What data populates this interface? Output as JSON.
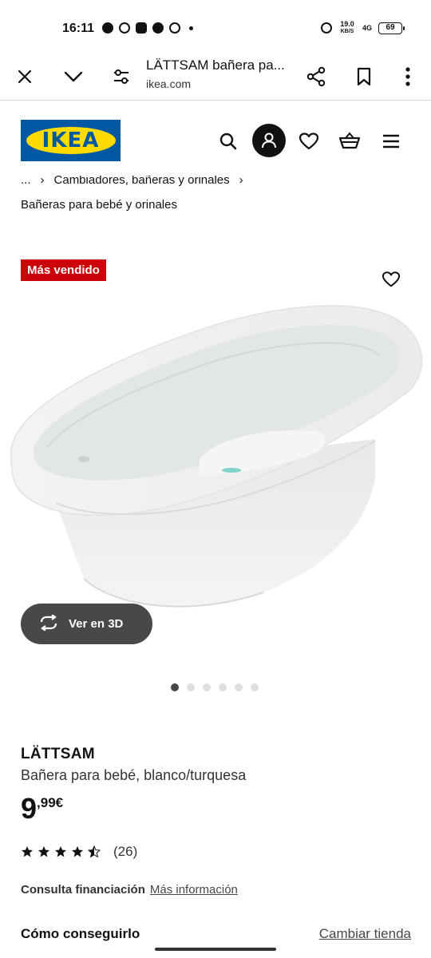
{
  "status_bar": {
    "time": "16:11",
    "net_speed_value": "19.0",
    "net_speed_unit": "KB/S",
    "signal": "4G",
    "battery": "69"
  },
  "browser": {
    "page_title": "LÄTTSAM bañera pa...",
    "domain": "ikea.com",
    "icons": [
      "close-icon",
      "chevron-down-icon",
      "tune-icon",
      "share-icon",
      "bookmark-icon",
      "more-vert-icon"
    ]
  },
  "header": {
    "logo_text": "IKEA",
    "logo_colors": {
      "blue": "#0058a3",
      "yellow": "#ffdb00"
    },
    "icons": [
      "search-icon",
      "account-icon",
      "heart-icon",
      "basket-icon",
      "menu-icon"
    ]
  },
  "breadcrumb": {
    "ellipsis": "...",
    "parent": "Cambiadores, bañeras y orinales",
    "current": "Bañeras para bebé y orinales"
  },
  "gallery": {
    "badge": "Más vendido",
    "badge_color": "#cc0008",
    "view3d_label": "Ver en 3D",
    "image_count": 6,
    "active_image": 1
  },
  "product": {
    "name": "LÄTTSAM",
    "description": "Bañera para bebé, blanco/turquesa",
    "price_integer": "9",
    "price_decimal": ",99€",
    "rating": 4.5,
    "review_count": "(26)"
  },
  "financing": {
    "label": "Consulta financiación",
    "link": "Más información"
  },
  "fulfillment": {
    "title": "Cómo conseguirlo",
    "change_store": "Cambiar tienda"
  }
}
